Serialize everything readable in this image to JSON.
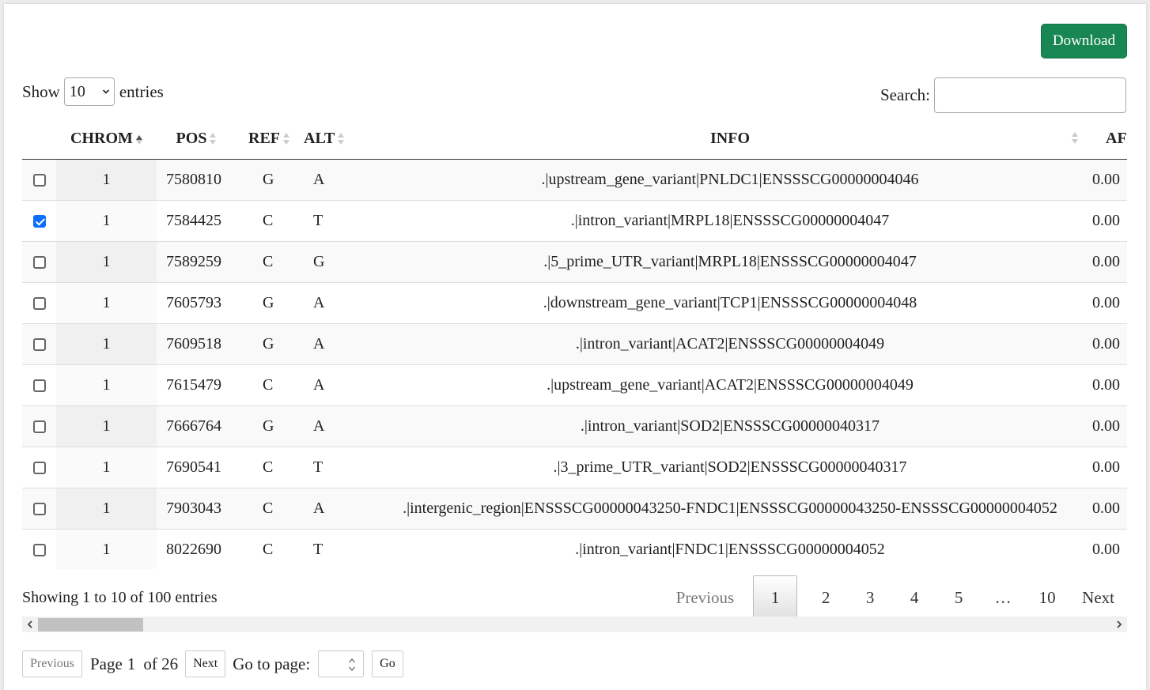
{
  "toolbar": {
    "download_label": "Download"
  },
  "length": {
    "prefix": "Show",
    "value": "10",
    "suffix": "entries"
  },
  "search": {
    "label": "Search:",
    "value": ""
  },
  "columns": [
    "CHROM",
    "POS",
    "REF",
    "ALT",
    "INFO",
    "AF"
  ],
  "sort": {
    "column": "CHROM",
    "direction": "ascending"
  },
  "rows": [
    {
      "checked": false,
      "chrom": "1",
      "pos": "7580810",
      "ref": "G",
      "alt": "A",
      "info": ".|upstream_gene_variant|PNLDC1|ENSSSCG00000004046",
      "af": "0.00"
    },
    {
      "checked": true,
      "chrom": "1",
      "pos": "7584425",
      "ref": "C",
      "alt": "T",
      "info": ".|intron_variant|MRPL18|ENSSSCG00000004047",
      "af": "0.00"
    },
    {
      "checked": false,
      "chrom": "1",
      "pos": "7589259",
      "ref": "C",
      "alt": "G",
      "info": ".|5_prime_UTR_variant|MRPL18|ENSSSCG00000004047",
      "af": "0.00"
    },
    {
      "checked": false,
      "chrom": "1",
      "pos": "7605793",
      "ref": "G",
      "alt": "A",
      "info": ".|downstream_gene_variant|TCP1|ENSSSCG00000004048",
      "af": "0.00"
    },
    {
      "checked": false,
      "chrom": "1",
      "pos": "7609518",
      "ref": "G",
      "alt": "A",
      "info": ".|intron_variant|ACAT2|ENSSSCG00000004049",
      "af": "0.00"
    },
    {
      "checked": false,
      "chrom": "1",
      "pos": "7615479",
      "ref": "C",
      "alt": "A",
      "info": ".|upstream_gene_variant|ACAT2|ENSSSCG00000004049",
      "af": "0.00"
    },
    {
      "checked": false,
      "chrom": "1",
      "pos": "7666764",
      "ref": "G",
      "alt": "A",
      "info": ".|intron_variant|SOD2|ENSSSCG00000040317",
      "af": "0.00"
    },
    {
      "checked": false,
      "chrom": "1",
      "pos": "7690541",
      "ref": "C",
      "alt": "T",
      "info": ".|3_prime_UTR_variant|SOD2|ENSSSCG00000040317",
      "af": "0.00"
    },
    {
      "checked": false,
      "chrom": "1",
      "pos": "7903043",
      "ref": "C",
      "alt": "A",
      "info": ".|intergenic_region|ENSSSCG00000043250-FNDC1|ENSSSCG00000043250-ENSSSCG00000004052",
      "af": "0.00"
    },
    {
      "checked": false,
      "chrom": "1",
      "pos": "8022690",
      "ref": "C",
      "alt": "T",
      "info": ".|intron_variant|FNDC1|ENSSSCG00000004052",
      "af": "0.00"
    }
  ],
  "info_text": "Showing 1 to 10 of 100 entries",
  "pagination": {
    "previous": "Previous",
    "pages": [
      "1",
      "2",
      "3",
      "4",
      "5",
      "…",
      "10"
    ],
    "current": "1",
    "next": "Next"
  },
  "bottom_pager": {
    "previous": "Previous",
    "page_prefix": "Page",
    "page_value": "1",
    "page_of": "of 26",
    "next": "Next",
    "goto_label": "Go to page:",
    "go": "Go"
  },
  "colors": {
    "download_bg": "#198754",
    "checkbox_on": "#0d6efd"
  },
  "icons": {
    "select": "chevron-down-icon",
    "sort": "sort-arrows-icon",
    "scroll_left": "chevron-left-icon",
    "scroll_right": "chevron-right-icon",
    "spinner": "spinner-arrows-icon"
  }
}
